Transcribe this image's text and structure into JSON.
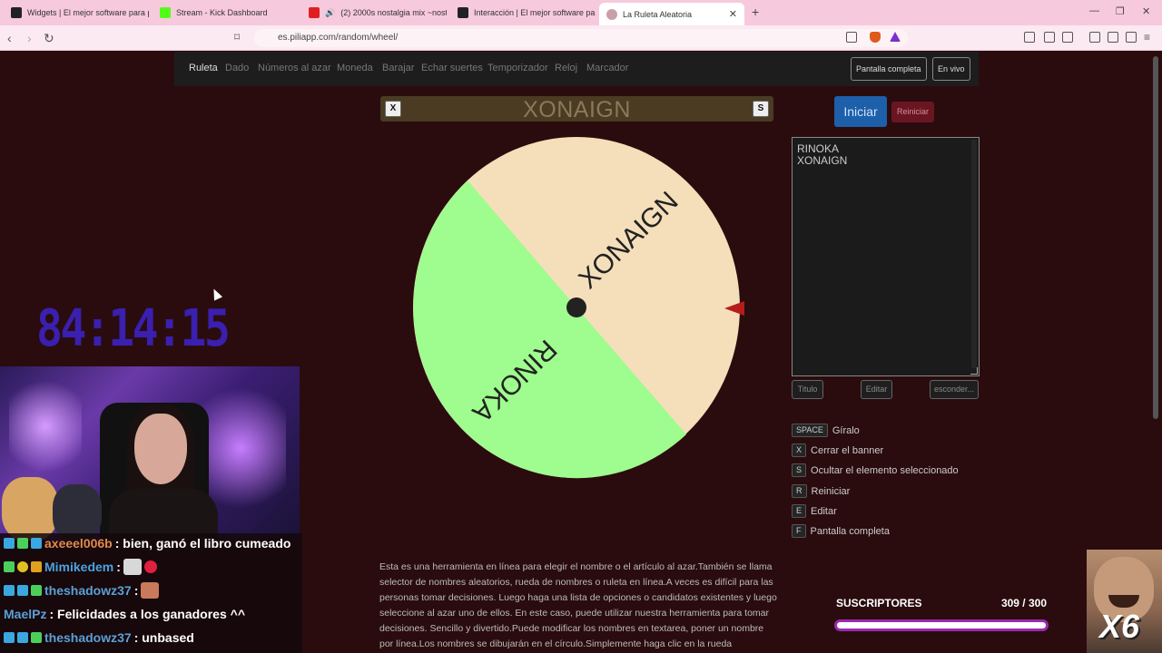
{
  "browser": {
    "tabs": [
      {
        "label": "Widgets | El mejor software para po",
        "icon": "streamlabs-icon",
        "color": "#222"
      },
      {
        "label": "Stream - Kick Dashboard",
        "icon": "kick-icon",
        "color": "#53fc18"
      },
      {
        "label": "(2) 2000s nostalgia mix ~nostalg",
        "icon": "youtube-icon",
        "color": "#e02020"
      },
      {
        "label": "Interacción | El mejor software para",
        "icon": "streamlabs-icon",
        "color": "#222"
      },
      {
        "label": "La Ruleta Aleatoria",
        "icon": "piliapp-icon",
        "color": "#b88"
      }
    ],
    "url": "es.piliapp.com/random/wheel/"
  },
  "site_nav": {
    "items": [
      "Ruleta",
      "Dado",
      "Números al azar",
      "Moneda",
      "Barajar",
      "Echar suertes",
      "Temporizador",
      "Reloj",
      "Marcador"
    ],
    "fullscreen_label": "Pantalla completa",
    "live_label": "En vivo"
  },
  "banner": {
    "title": "XONAIGN",
    "close_key": "X",
    "hide_key": "S"
  },
  "wheel": {
    "segments": [
      {
        "label": "XONAIGN",
        "color": "#f5dfba"
      },
      {
        "label": "RINOKA",
        "color": "#9ffc8e"
      }
    ],
    "selected": "XONAIGN"
  },
  "controls": {
    "start_label": "Iniciar",
    "reset_label": "Reiniciar",
    "names": [
      "RINOKA",
      "XONAIGN"
    ],
    "title_btn": "Titulo",
    "edit_btn": "Editar",
    "hide_btn": "esconder..."
  },
  "shortcuts": [
    {
      "key": "SPACE",
      "label": "Gíralo"
    },
    {
      "key": "X",
      "label": "Cerrar el banner"
    },
    {
      "key": "S",
      "label": "Ocultar el elemento seleccionado"
    },
    {
      "key": "R",
      "label": "Reiniciar"
    },
    {
      "key": "E",
      "label": "Editar"
    },
    {
      "key": "F",
      "label": "Pantalla completa"
    }
  ],
  "description": "Esta es una herramienta en línea para elegir el nombre o el artículo al azar.También se llama selector de nombres aleatorios, rueda de nombres o ruleta en línea.A veces es difícil para las personas tomar decisiones. Luego haga una lista de opciones o candidatos existentes y luego seleccione al azar uno de ellos. En este caso, puede utilizar nuestra herramienta para tomar decisiones. Sencillo y divertido.Puede modificar los nombres en textarea, poner un nombre por línea.Los nombres se dibujarán en el círculo.Simplemente haga clic en la rueda",
  "overlay": {
    "timer": "84:14:15",
    "chat": [
      {
        "user": "axeeel006b",
        "msg": ": bien, ganó el libro cumeado",
        "color": "#e08a4e"
      },
      {
        "user": "Mimikedem",
        "msg": ":",
        "color": "#4aa3e0"
      },
      {
        "user": "theshadowz37",
        "msg": ":",
        "color": "#5aa0d8"
      },
      {
        "user": "MaelPz",
        "msg": ": Felicidades a los ganadores ^^",
        "color": "#5aa0d8"
      },
      {
        "user": "theshadowz37",
        "msg": ": unbased",
        "color": "#5aa0d8"
      }
    ],
    "subs_label": "SUSCRIPTORES",
    "subs_count": "309 / 300",
    "subs_progress": 1.0,
    "meme_text": "X6"
  }
}
